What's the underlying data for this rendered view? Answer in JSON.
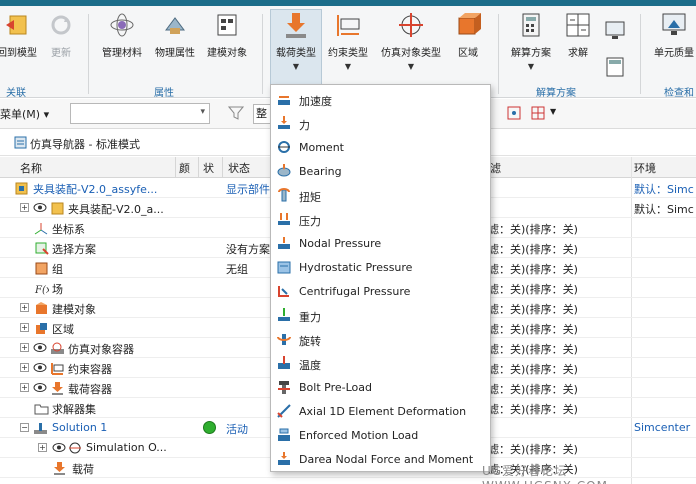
{
  "ribbon": {
    "buttons": [
      {
        "label": "回到模型",
        "icon": "return-model-icon",
        "disabled": false
      },
      {
        "label": "更新",
        "icon": "update-icon",
        "disabled": true
      },
      {
        "label": "管理材料",
        "icon": "manage-materials-icon",
        "disabled": false
      },
      {
        "label": "物理属性",
        "icon": "physical-properties-icon",
        "disabled": false
      },
      {
        "label": "建模对象",
        "icon": "modeling-objects-icon",
        "disabled": false
      },
      {
        "label": "载荷类型",
        "icon": "load-type-icon",
        "active": true
      },
      {
        "label": "约束类型",
        "icon": "constraint-type-icon"
      },
      {
        "label": "仿真对象类型",
        "icon": "simulation-object-type-icon"
      },
      {
        "label": "区域",
        "icon": "region-icon"
      },
      {
        "label": "解算方案",
        "icon": "solution-icon"
      },
      {
        "label": "求解",
        "icon": "solve-icon"
      },
      {
        "label": "单元质量",
        "icon": "element-quality-icon"
      }
    ],
    "groups": [
      "关联",
      "属性",
      "解算方案",
      "检查和"
    ]
  },
  "filterbar": {
    "menu_label": "菜单(M) ▾",
    "box_text": "整"
  },
  "navigator": {
    "title": "仿真导航器 - 标准模式"
  },
  "table": {
    "headers": [
      "名称",
      "颜",
      "状",
      "状态",
      "滤",
      "环境"
    ],
    "rows": [
      {
        "name": "夹具装配-V2.0_assyfe...",
        "status": "显示部件",
        "env": "默认：Simc"
      },
      {
        "name": "夹具装配-V2.0_a...",
        "env": "默认：Simc"
      },
      {
        "name": "坐标系",
        "filter": "滤：关)(排序：关)"
      },
      {
        "name": "选择方案",
        "status": "没有方案",
        "filter": "滤：关)(排序：关)"
      },
      {
        "name": "组",
        "status": "无组",
        "filter": "滤：关)(排序：关)"
      },
      {
        "name": "场",
        "filter": "滤：关)(排序：关)"
      },
      {
        "name": "建模对象",
        "filter": "滤：关)(排序：关)"
      },
      {
        "name": "区域",
        "filter": "滤：关)(排序：关)"
      },
      {
        "name": "仿真对象容器",
        "filter": "滤：关)(排序：关)"
      },
      {
        "name": "约束容器",
        "filter": "滤：关)(排序：关)"
      },
      {
        "name": "载荷容器",
        "filter": "滤：关)(排序：关)"
      },
      {
        "name": "求解器集",
        "filter": "滤：关)(排序：关)"
      },
      {
        "name": "Solution 1",
        "status": "活动",
        "env": "Simcenter"
      },
      {
        "name": "Simulation O...",
        "filter": "滤：关)(排序：关)"
      },
      {
        "name": "载荷",
        "filter": "滤：关)(排序：关)"
      }
    ]
  },
  "dropdown": {
    "items": [
      {
        "label": "加速度",
        "icon": "acceleration-icon"
      },
      {
        "label": "力",
        "icon": "force-icon"
      },
      {
        "label": "Moment",
        "icon": "moment-icon"
      },
      {
        "label": "Bearing",
        "icon": "bearing-icon"
      },
      {
        "label": "扭矩",
        "icon": "torque-icon"
      },
      {
        "label": "压力",
        "icon": "pressure-icon"
      },
      {
        "label": "Nodal Pressure",
        "icon": "nodal-pressure-icon"
      },
      {
        "label": "Hydrostatic Pressure",
        "icon": "hydrostatic-pressure-icon"
      },
      {
        "label": "Centrifugal Pressure",
        "icon": "centrifugal-pressure-icon"
      },
      {
        "label": "重力",
        "icon": "gravity-icon"
      },
      {
        "label": "旋转",
        "icon": "rotation-icon"
      },
      {
        "label": "温度",
        "icon": "temperature-icon"
      },
      {
        "label": "Bolt Pre-Load",
        "icon": "bolt-preload-icon"
      },
      {
        "label": "Axial 1D Element Deformation",
        "icon": "axial-1d-deformation-icon"
      },
      {
        "label": "Enforced Motion Load",
        "icon": "enforced-motion-icon"
      },
      {
        "label": "Darea Nodal Force and Moment",
        "icon": "darea-nodal-force-icon"
      }
    ]
  },
  "watermark": "UG爱好者论坛  WWW.UGSNX.COM",
  "colors": {
    "accent": "#1c6d8a",
    "link": "#1a5fb4",
    "active_dot": "#2fae2f"
  }
}
